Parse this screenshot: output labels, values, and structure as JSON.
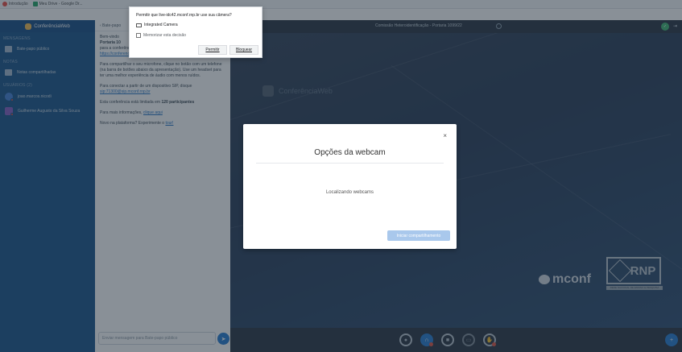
{
  "browser": {
    "bookmarks": [
      {
        "label": "Introdução",
        "color": "#e8453c"
      },
      {
        "label": "Meu Drive - Google Dr...",
        "color": "#1aa260"
      }
    ]
  },
  "permission_popup": {
    "question": "Permitir que live-idc42.mconf.rnp.br use sua câmera?",
    "device": "Integrated Camera",
    "remember": "Memorizar esta decisão",
    "allow": "Permitir",
    "block": "Bloquear"
  },
  "sidebar": {
    "logo": "ConferênciaWeb",
    "sections": [
      {
        "label": "MENSAGENS"
      },
      {
        "label": "NOTAS"
      },
      {
        "label": "USUÁRIOS (2)"
      }
    ],
    "items": [
      {
        "label": "Bate-papo público"
      },
      {
        "label": "Notas compartilhadas"
      }
    ],
    "users": [
      {
        "name": "joao.marcos.nicodi",
        "color": "#3a7bd5"
      },
      {
        "name": "Guilherme Augusto da Silva Souza",
        "color": "#7e57c2"
      }
    ]
  },
  "chat": {
    "header": "‹ Bate-papo",
    "messages": {
      "welcome_prefix": "Bem-vindo",
      "welcome_line2": "Portaria 10",
      "welcome_line3": "para a conferência, envie o link:",
      "link": "https://conferenciaweb.rnp.br/webconf/comissao-heteroidentificacao",
      "mic": "Para compartilhar o seu microfone, clique no botão com um telefone (na barra de botões abaixo da apresentação). Use um headset para ter uma melhor experiência de áudio com menos ruídos.",
      "sip": "Para conectar a partir de um dispositivo SIP, disque",
      "sip_link": "sip:71300@sip.mconf.rnp.br",
      "limit_prefix": "Esta conferência está limitada em",
      "limit_value": "120 participantes",
      "info_prefix": "Para mais informações,",
      "info_link": "clique aqui",
      "new_prefix": "Novo na plataforma? Experimente o",
      "new_link": "tour!"
    },
    "input_placeholder": "Enviar mensagem para Bate-papo público"
  },
  "topbar": {
    "title": "Comissão Heteroidentificação - Portaria 1099/22"
  },
  "stage": {
    "logo_text": "ConferênciaWeb",
    "mconf_text": "mconf",
    "rnp_text": "RNP",
    "rnp_sub": "REDE NACIONAL DE ENSINO E PESQUISA"
  },
  "modal": {
    "title": "Opções da webcam",
    "status": "Localizando webcams",
    "share_button": "Iniciar compartilhamento",
    "close": "×"
  }
}
